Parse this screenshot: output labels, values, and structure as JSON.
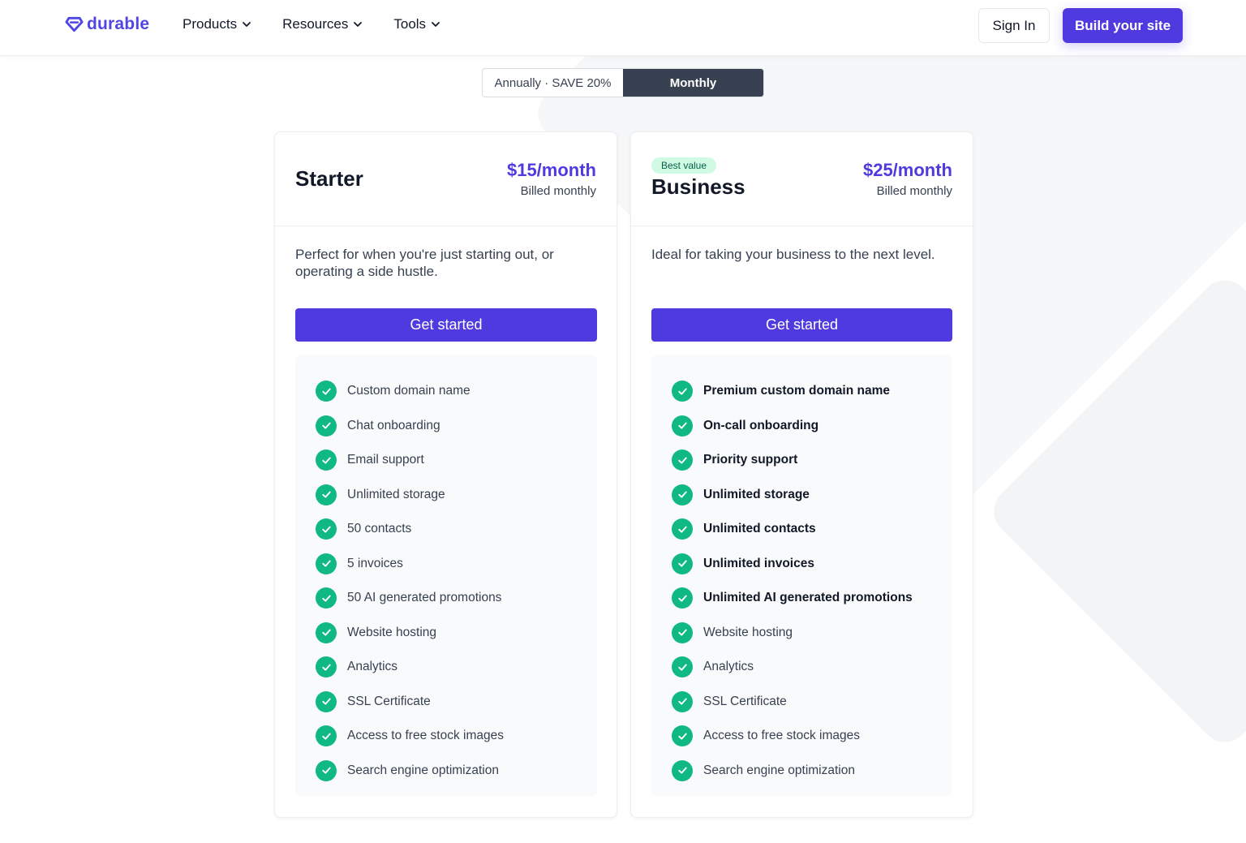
{
  "brand": {
    "name": "durable",
    "color": "#4f46e5"
  },
  "nav": [
    {
      "label": "Products"
    },
    {
      "label": "Resources"
    },
    {
      "label": "Tools"
    }
  ],
  "auth": {
    "signin_label": "Sign In",
    "build_label": "Build your site"
  },
  "billing_toggle": {
    "annual_label": "Annually · SAVE 20%",
    "monthly_label": "Monthly",
    "selected": "Monthly"
  },
  "plans": [
    {
      "name": "Starter",
      "price": "$15/month",
      "billing": "Billed monthly",
      "description": "Perfect for when you're just starting out, or operating a side hustle.",
      "cta": "Get started",
      "features": [
        {
          "text": "Custom domain name",
          "bold": false
        },
        {
          "text": "Chat onboarding",
          "bold": false
        },
        {
          "text": "Email support",
          "bold": false
        },
        {
          "text": "Unlimited storage",
          "bold": false
        },
        {
          "text": "50 contacts",
          "bold": false
        },
        {
          "text": "5 invoices",
          "bold": false
        },
        {
          "text": "50 AI generated promotions",
          "bold": false
        },
        {
          "text": "Website hosting",
          "bold": false
        },
        {
          "text": "Analytics",
          "bold": false
        },
        {
          "text": "SSL Certificate",
          "bold": false
        },
        {
          "text": "Access to free stock images",
          "bold": false
        },
        {
          "text": "Search engine optimization",
          "bold": false
        }
      ]
    },
    {
      "badge": "Best value",
      "name": "Business",
      "price": "$25/month",
      "billing": "Billed monthly",
      "description": "Ideal for taking your business to the next level.",
      "cta": "Get started",
      "features": [
        {
          "text": "Premium custom domain name",
          "bold": true
        },
        {
          "text": "On-call onboarding",
          "bold": true
        },
        {
          "text": "Priority support",
          "bold": true
        },
        {
          "text": "Unlimited storage",
          "bold": true
        },
        {
          "text": "Unlimited contacts",
          "bold": true
        },
        {
          "text": "Unlimited invoices",
          "bold": true
        },
        {
          "text": "Unlimited AI generated promotions",
          "bold": true
        },
        {
          "text": "Website hosting",
          "bold": false
        },
        {
          "text": "Analytics",
          "bold": false
        },
        {
          "text": "SSL Certificate",
          "bold": false
        },
        {
          "text": "Access to free stock images",
          "bold": false
        },
        {
          "text": "Search engine optimization",
          "bold": false
        }
      ]
    }
  ],
  "colors": {
    "accent": "#4f3ae0",
    "check": "#10b981",
    "badge_bg": "#d1fae5",
    "toggle_active": "#374151"
  },
  "icons": {
    "brand": "diamond-logo-icon",
    "dropdown": "chevron-down-icon",
    "feature": "check-circle-icon"
  }
}
